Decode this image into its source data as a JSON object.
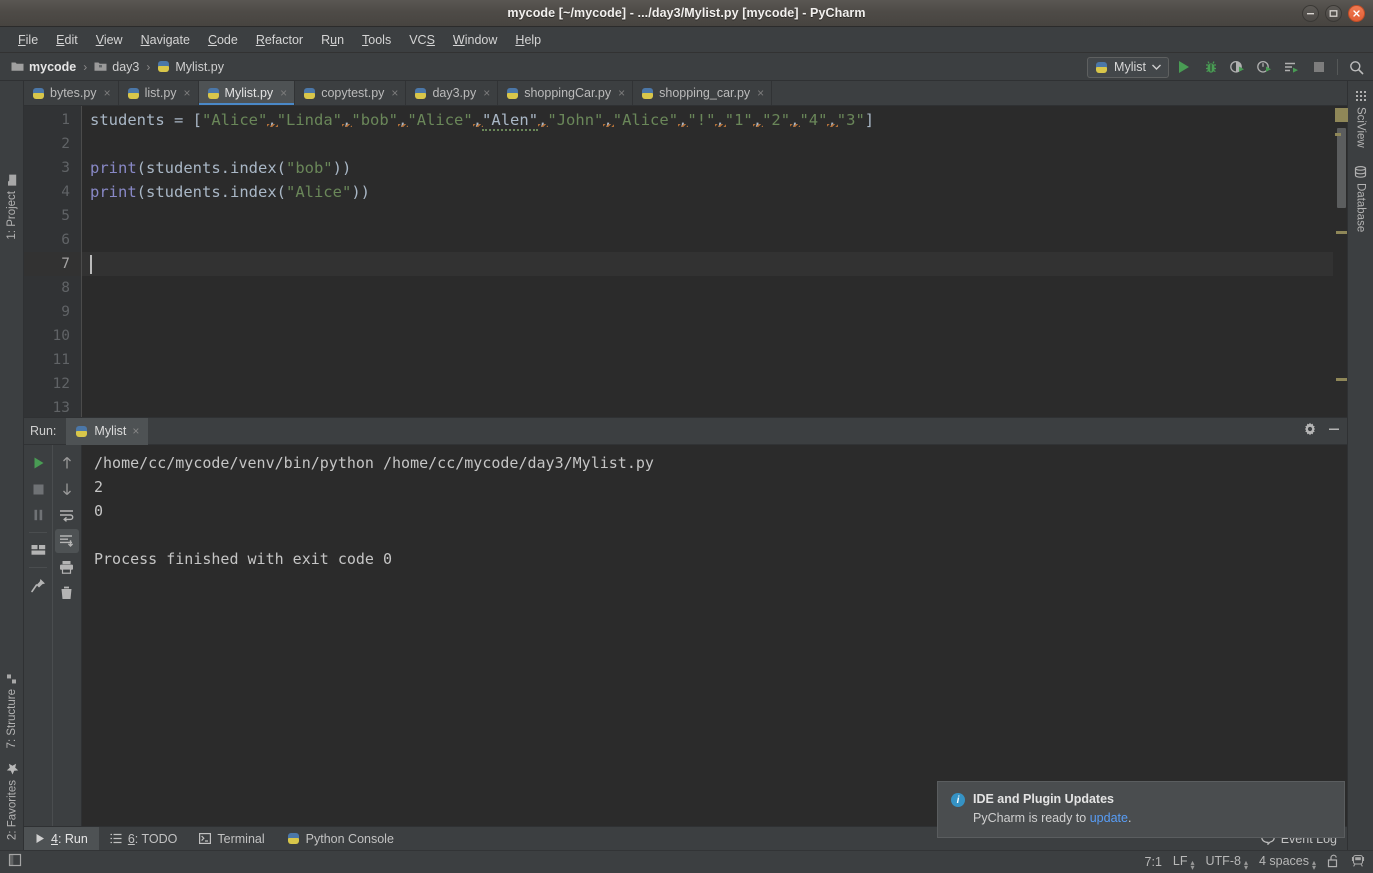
{
  "window": {
    "title": "mycode [~/mycode] - .../day3/Mylist.py [mycode] - PyCharm",
    "controls": {
      "minimize": "minimize-button",
      "maximize": "maximize-button",
      "close": "close-button"
    }
  },
  "menu": {
    "items": [
      {
        "label": "File",
        "mnemonic": "F"
      },
      {
        "label": "Edit",
        "mnemonic": "E"
      },
      {
        "label": "View",
        "mnemonic": "V"
      },
      {
        "label": "Navigate",
        "mnemonic": "N"
      },
      {
        "label": "Code",
        "mnemonic": "C"
      },
      {
        "label": "Refactor",
        "mnemonic": "R"
      },
      {
        "label": "Run",
        "mnemonic": "u"
      },
      {
        "label": "Tools",
        "mnemonic": "T"
      },
      {
        "label": "VCS",
        "mnemonic": "S"
      },
      {
        "label": "Window",
        "mnemonic": "W"
      },
      {
        "label": "Help",
        "mnemonic": "H"
      }
    ]
  },
  "breadcrumb": {
    "items": [
      {
        "label": "mycode",
        "icon": "folder-icon"
      },
      {
        "label": "day3",
        "icon": "folder-icon"
      },
      {
        "label": "Mylist.py",
        "icon": "python-file-icon"
      }
    ],
    "separator": "›"
  },
  "run_toolbar": {
    "config_name": "Mylist",
    "config_icon": "python-icon",
    "dropdown_icon": "chevron-down-icon",
    "buttons": [
      {
        "name": "run-button",
        "icon": "play-icon",
        "color": "#499c54"
      },
      {
        "name": "debug-button",
        "icon": "bug-icon",
        "color": "#499c54"
      },
      {
        "name": "coverage-button",
        "icon": "coverage-icon",
        "color": "#499c54"
      },
      {
        "name": "profile-button",
        "icon": "profile-icon",
        "color": "#499c54"
      },
      {
        "name": "run-with-params-button",
        "icon": "run-list-icon",
        "color": "#499c54"
      },
      {
        "name": "stop-button",
        "icon": "stop-icon",
        "color": "#808080"
      },
      {
        "name": "search-everywhere-button",
        "icon": "search-icon",
        "color": "#b0b0b0"
      }
    ]
  },
  "left_rail": {
    "items": [
      {
        "label": "1: Project",
        "mnemonic": "1",
        "icon": "project-icon"
      },
      {
        "label": "7: Structure",
        "mnemonic": "7",
        "icon": "structure-icon"
      },
      {
        "label": "2: Favorites",
        "mnemonic": "2",
        "icon": "star-icon"
      }
    ]
  },
  "right_rail": {
    "items": [
      {
        "label": "SciView",
        "icon": "grid-icon"
      },
      {
        "label": "Database",
        "icon": "database-icon"
      }
    ]
  },
  "editor_tabs": {
    "tabs": [
      {
        "label": "bytes.py",
        "active": false
      },
      {
        "label": "list.py",
        "active": false
      },
      {
        "label": "Mylist.py",
        "active": true
      },
      {
        "label": "copytest.py",
        "active": false
      },
      {
        "label": "day3.py",
        "active": false
      },
      {
        "label": "shoppingCar.py",
        "active": false
      },
      {
        "label": "shopping_car.py",
        "active": false
      }
    ],
    "close_glyph": "×"
  },
  "editor": {
    "line_numbers": [
      "1",
      "2",
      "3",
      "4",
      "5",
      "6",
      "7",
      "8",
      "9",
      "10",
      "11",
      "12",
      "13"
    ],
    "current_line": 7,
    "lines": [
      {
        "n": 1,
        "tokens": [
          {
            "t": "students ",
            "c": "pn"
          },
          {
            "t": "= ",
            "c": "pn"
          },
          {
            "t": "[",
            "c": "br"
          },
          {
            "t": "\"Alice\"",
            "c": "str"
          },
          {
            "t": ",",
            "c": "comma"
          },
          {
            "t": "\"Linda\"",
            "c": "str"
          },
          {
            "t": ",",
            "c": "comma"
          },
          {
            "t": "\"bob\"",
            "c": "str"
          },
          {
            "t": ",",
            "c": "comma"
          },
          {
            "t": "\"Alice\"",
            "c": "str"
          },
          {
            "t": ",",
            "c": "comma"
          },
          {
            "t": "\"Alen\"",
            "c": "typo"
          },
          {
            "t": ",",
            "c": "comma"
          },
          {
            "t": "\"John\"",
            "c": "str"
          },
          {
            "t": ",",
            "c": "comma"
          },
          {
            "t": "\"Alice\"",
            "c": "str"
          },
          {
            "t": ",",
            "c": "comma"
          },
          {
            "t": "\"!\"",
            "c": "str"
          },
          {
            "t": ",",
            "c": "comma"
          },
          {
            "t": "\"1\"",
            "c": "str"
          },
          {
            "t": ",",
            "c": "comma"
          },
          {
            "t": "\"2\"",
            "c": "str"
          },
          {
            "t": ",",
            "c": "comma"
          },
          {
            "t": "\"4\"",
            "c": "str"
          },
          {
            "t": ",",
            "c": "comma"
          },
          {
            "t": "\"3\"",
            "c": "str"
          },
          {
            "t": "]",
            "c": "br"
          }
        ]
      },
      {
        "n": 2,
        "tokens": []
      },
      {
        "n": 3,
        "tokens": [
          {
            "t": "print",
            "c": "bi"
          },
          {
            "t": "(students.index(",
            "c": "pn"
          },
          {
            "t": "\"bob\"",
            "c": "str"
          },
          {
            "t": "))",
            "c": "pn"
          }
        ]
      },
      {
        "n": 4,
        "tokens": [
          {
            "t": "print",
            "c": "bi"
          },
          {
            "t": "(students.index(",
            "c": "pn"
          },
          {
            "t": "\"Alice\"",
            "c": "str"
          },
          {
            "t": "))",
            "c": "pn"
          }
        ]
      },
      {
        "n": 5,
        "tokens": []
      },
      {
        "n": 6,
        "tokens": []
      },
      {
        "n": 7,
        "tokens": []
      },
      {
        "n": 8,
        "tokens": []
      },
      {
        "n": 9,
        "tokens": []
      },
      {
        "n": 10,
        "tokens": []
      },
      {
        "n": 11,
        "tokens": []
      },
      {
        "n": 12,
        "tokens": []
      },
      {
        "n": 13,
        "tokens": []
      }
    ],
    "code_text_line1": "students = [\"Alice\",\"Linda\",\"bob\",\"Alice\",\"Alen\",\"John\",\"Alice\",\"!\",\"1\",\"2\",\"4\",\"3\"]",
    "code_text_line3": "print(students.index(\"bob\"))",
    "code_text_line4": "print(students.index(\"Alice\"))"
  },
  "run_panel": {
    "label": "Run:",
    "tab_label": "Mylist",
    "tab_icon": "python-icon",
    "close_glyph": "×",
    "settings_icon": "gear-icon",
    "minimize_icon": "minimize-icon",
    "side_buttons": [
      {
        "name": "rerun-button",
        "icon": "play-icon"
      },
      {
        "name": "stop-button",
        "icon": "stop-icon"
      },
      {
        "name": "pause-button",
        "icon": "pause-icon"
      },
      {
        "name": "layout-button",
        "icon": "layout-icon"
      },
      {
        "name": "pin-button",
        "icon": "pin-icon"
      },
      {
        "name": "up-button",
        "icon": "arrow-up-icon"
      },
      {
        "name": "down-button",
        "icon": "arrow-down-icon"
      },
      {
        "name": "soft-wrap-button",
        "icon": "wrap-icon"
      },
      {
        "name": "scroll-to-end-button",
        "icon": "scroll-end-icon",
        "selected": true
      },
      {
        "name": "print-button",
        "icon": "printer-icon"
      },
      {
        "name": "clear-all-button",
        "icon": "trash-icon"
      }
    ],
    "console_lines": [
      "/home/cc/mycode/venv/bin/python /home/cc/mycode/day3/Mylist.py",
      "2",
      "0",
      "",
      "Process finished with exit code 0"
    ]
  },
  "notification": {
    "icon": "info-icon",
    "title": "IDE and Plugin Updates",
    "body_prefix": "PyCharm is ready to ",
    "link": "update",
    "body_suffix": "."
  },
  "bottom_bar": {
    "tabs": [
      {
        "label": "4: Run",
        "mnemonic": "4",
        "icon": "play-icon",
        "active": true
      },
      {
        "label": "6: TODO",
        "mnemonic": "6",
        "icon": "todo-icon",
        "active": false
      },
      {
        "label": "Terminal",
        "icon": "terminal-icon",
        "active": false
      },
      {
        "label": "Python Console",
        "icon": "python-icon",
        "active": false
      }
    ],
    "event_log": {
      "label": "Event Log",
      "icon": "balloon-icon"
    }
  },
  "status_bar": {
    "caret_position": "7:1",
    "line_separator": "LF",
    "encoding": "UTF-8",
    "indent": "4 spaces",
    "lock_icon": "unlocked-icon",
    "train_icon": "train-icon",
    "left_icon": "toggle-tool-window-icon"
  },
  "colors": {
    "accent_blue": "#4a88c7",
    "green_run": "#499c54",
    "string_green": "#6a8759",
    "keyword_orange": "#cc7832",
    "builtin_purple": "#8888c6",
    "editor_bg": "#2b2b2b",
    "panel_bg": "#3c3f41",
    "link_blue": "#589df6"
  }
}
